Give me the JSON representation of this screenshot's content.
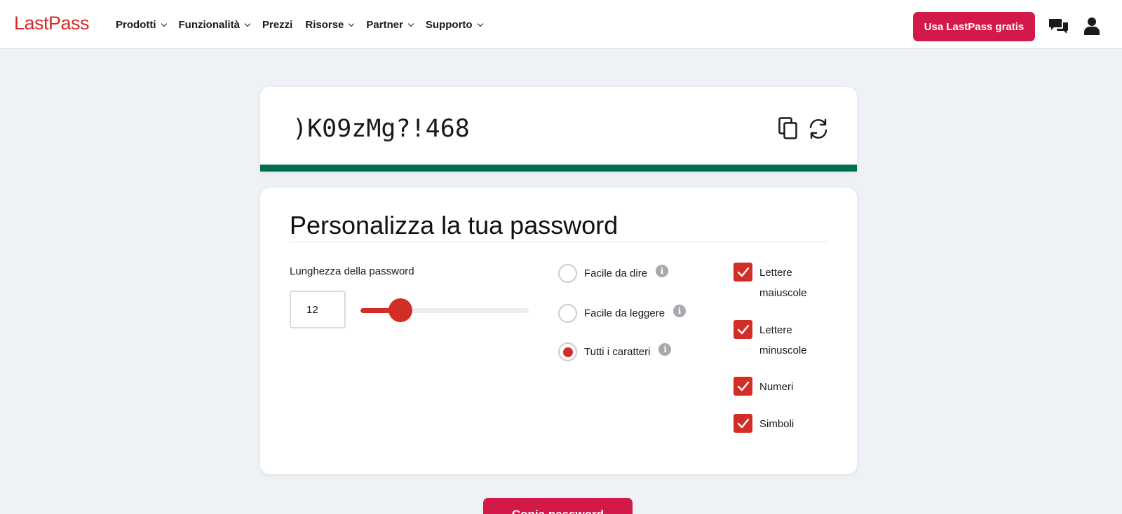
{
  "header": {
    "logo": "LastPass",
    "nav": [
      {
        "label": "Prodotti",
        "dropdown": true
      },
      {
        "label": "Funzionalità",
        "dropdown": true
      },
      {
        "label": "Prezzi",
        "dropdown": false
      },
      {
        "label": "Risorse",
        "dropdown": true
      },
      {
        "label": "Partner",
        "dropdown": true
      },
      {
        "label": "Supporto",
        "dropdown": true
      }
    ],
    "cta_label": "Usa LastPass gratis",
    "icons": {
      "chat": "chat-bubbles-icon",
      "account": "user-icon"
    }
  },
  "generator": {
    "password": ")K09zMg?!468",
    "copy_icon": "copy-icon",
    "refresh_icon": "refresh-icon",
    "strength_color": "#006f4f"
  },
  "options": {
    "title": "Personalizza la tua password",
    "length_label": "Lunghezza della password",
    "length_value": "12",
    "slider_fraction": 0.2,
    "modes": [
      {
        "label": "Facile da dire",
        "selected": false
      },
      {
        "label": "Facile da leggere",
        "selected": false
      },
      {
        "label": "Tutti i caratteri",
        "selected": true
      }
    ],
    "info_glyph": "i",
    "char_types": [
      {
        "label": "Lettere maiuscole",
        "checked": true
      },
      {
        "label": "Lettere minuscole",
        "checked": true
      },
      {
        "label": "Numeri",
        "checked": true
      },
      {
        "label": "Simboli",
        "checked": true
      }
    ]
  },
  "bottom_button": "Copia password",
  "colors": {
    "accent": "#d32d27",
    "cta": "#d3184a",
    "background": "#eef1f5"
  }
}
